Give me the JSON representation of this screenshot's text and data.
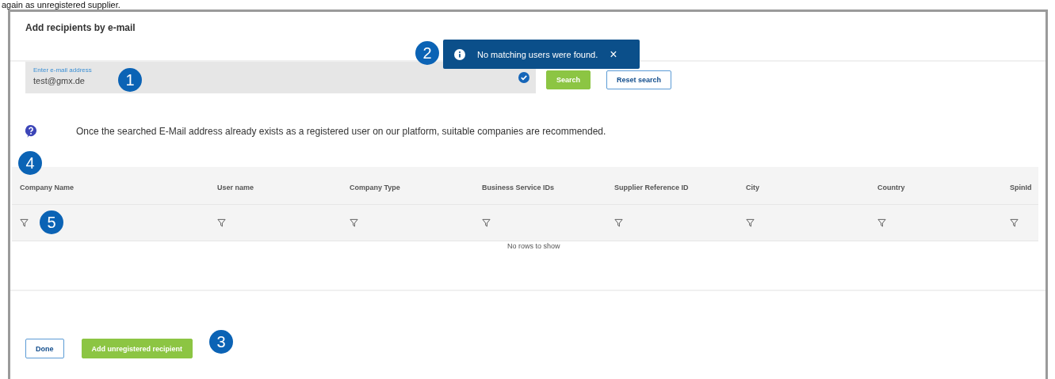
{
  "caption": "again as unregistered supplier.",
  "dialog": {
    "title": "Add recipients by e-mail"
  },
  "email_field": {
    "label": "Enter e-mail address",
    "value": "test@gmx.de",
    "valid": true,
    "badge": "1"
  },
  "buttons": [
    {
      "label": "Search",
      "kind": "primary"
    },
    {
      "label": "Reset search",
      "kind": "secondary"
    }
  ],
  "toast": {
    "message": "No matching users were found.",
    "close": "×",
    "badge": "2"
  },
  "help_text": "Once the searched E-Mail address already exists as a registered user on our platform, suitable companies are recommended.",
  "table": {
    "badge": "4",
    "filter_badge": "5",
    "columns": [
      {
        "label": "Company Name"
      },
      {
        "label": "User name"
      },
      {
        "label": "Company Type"
      },
      {
        "label": "Business Service IDs"
      },
      {
        "label": "Supplier Reference ID"
      },
      {
        "label": "City"
      },
      {
        "label": "Country"
      },
      {
        "label": "SpinId"
      }
    ],
    "empty_text": "No rows to show"
  },
  "footer_buttons": [
    {
      "label": "Done",
      "kind": "secondary"
    },
    {
      "label": "Add unregistered recipient",
      "kind": "primary"
    }
  ],
  "footer_badge": "3"
}
